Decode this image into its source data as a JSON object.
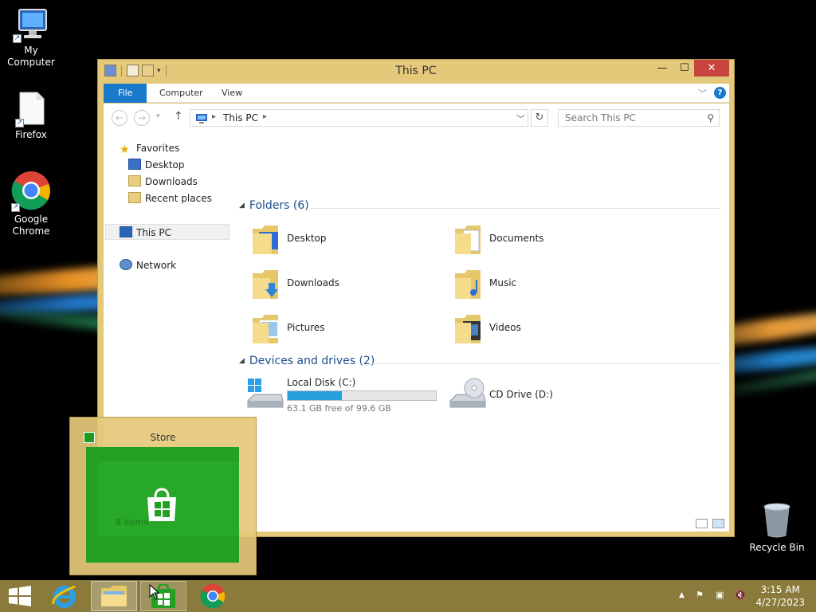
{
  "desktop": {
    "icons": [
      {
        "label": "My Computer"
      },
      {
        "label": "Firefox"
      },
      {
        "label": "Google Chrome"
      },
      {
        "label": "Recycle Bin"
      }
    ]
  },
  "window": {
    "title": "This PC",
    "controls": {
      "minimize": "—",
      "maximize": "☐",
      "close": "✕"
    },
    "ribbon_tabs": [
      "File",
      "Computer",
      "View"
    ],
    "help": "?",
    "address": {
      "crumb": "This PC"
    },
    "search_placeholder": "Search This PC",
    "nav": {
      "favorites": "Favorites",
      "desktop": "Desktop",
      "downloads": "Downloads",
      "recent": "Recent places",
      "thispc": "This PC",
      "network": "Network"
    },
    "folders_header": "Folders (6)",
    "folders": [
      "Desktop",
      "Documents",
      "Downloads",
      "Music",
      "Pictures",
      "Videos"
    ],
    "devices_header": "Devices and drives (2)",
    "drives": {
      "local": {
        "name": "Local Disk (C:)",
        "free_text": "63.1 GB free of 99.6 GB",
        "used_fraction": 0.366
      },
      "cd": {
        "name": "CD Drive (D:)"
      }
    },
    "status_items": "8 items"
  },
  "preview": {
    "title": "Store"
  },
  "taskbar": {
    "time": "3:15 AM",
    "date": "4/27/2023"
  }
}
